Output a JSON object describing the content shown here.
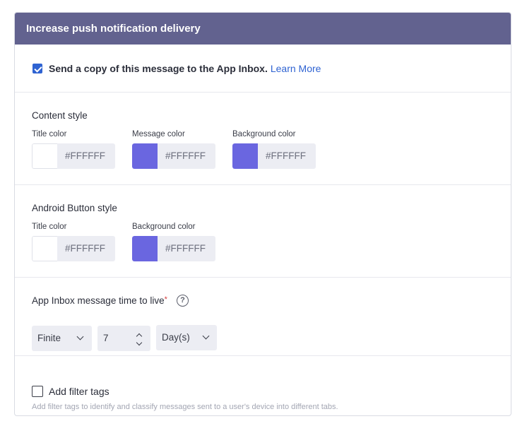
{
  "header": {
    "title": "Increase push notification delivery"
  },
  "inbox": {
    "checked": true,
    "label": "Send a copy of this message to the App Inbox.",
    "link": "Learn More"
  },
  "content_style": {
    "title": "Content style",
    "fields": [
      {
        "label": "Title color",
        "value": "#FFFFFF",
        "swatch": "#ffffff"
      },
      {
        "label": "Message color",
        "value": "#FFFFFF",
        "swatch": "#6a66e0"
      },
      {
        "label": "Background color",
        "value": "#FFFFFF",
        "swatch": "#6a66e0"
      }
    ]
  },
  "android_style": {
    "title": "Android Button style",
    "fields": [
      {
        "label": "Title color",
        "value": "#FFFFFF",
        "swatch": "#ffffff"
      },
      {
        "label": "Background color",
        "value": "#FFFFFF",
        "swatch": "#6a66e0"
      }
    ]
  },
  "ttl": {
    "title": "App Inbox message time to live",
    "required_mark": "*",
    "help_icon": "question-circle-icon",
    "help_glyph": "?",
    "type_value": "Finite",
    "amount_value": "7",
    "unit_value": "Day(s)"
  },
  "tags": {
    "checked": false,
    "label": "Add filter tags",
    "help": "Add filter tags to identify and classify messages sent to a user's device into different tabs."
  },
  "colors": {
    "header_bg": "#62628f",
    "accent": "#2f63d2",
    "swatch_purple": "#6a66e0"
  }
}
